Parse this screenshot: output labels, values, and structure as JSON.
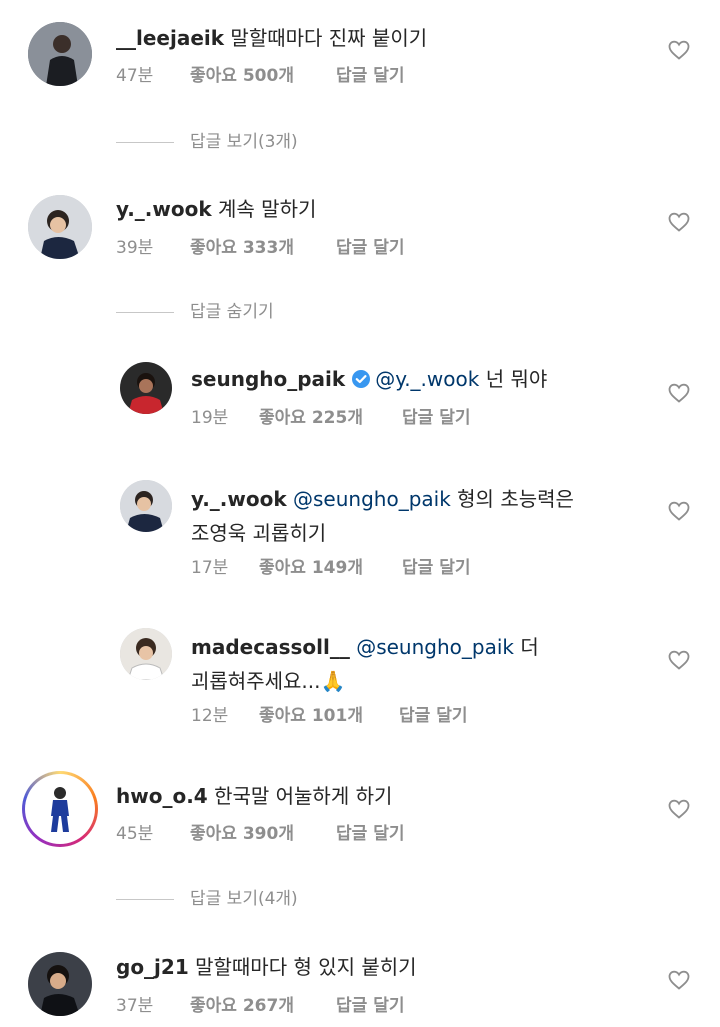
{
  "colors": {
    "mention": "#00376b",
    "meta": "#8e8e8e",
    "verified": "#3897f0"
  },
  "comments": [
    {
      "username": "__leejaeik",
      "text": "말할때마다 진짜 붙이기",
      "time": "47분",
      "likes": "좋아요 500개",
      "reply": "답글 달기",
      "thread": "답글 보기(3개)"
    },
    {
      "username": "y._.wook",
      "text": "계속 말하기",
      "time": "39분",
      "likes": "좋아요 333개",
      "reply": "답글 달기",
      "thread": "답글 숨기기"
    },
    {
      "username": "seungho_paik",
      "mention": "@y._.wook",
      "text": "넌 뭐야",
      "time": "19분",
      "likes": "좋아요 225개",
      "reply": "답글 달기"
    },
    {
      "username": "y._.wook",
      "mention": "@seungho_paik",
      "text": "형의 초능력은",
      "text_line2": "조영욱 괴롭히기",
      "time": "17분",
      "likes": "좋아요 149개",
      "reply": "답글 달기"
    },
    {
      "username": "madecassoll__",
      "mention": "@seungho_paik",
      "text": "더",
      "text_line2": "괴롭혀주세요...🙏",
      "time": "12분",
      "likes": "좋아요 101개",
      "reply": "답글 달기"
    },
    {
      "username": "hwo_o.4",
      "text": "한국말 어눌하게 하기",
      "time": "45분",
      "likes": "좋아요 390개",
      "reply": "답글 달기",
      "thread": "답글 보기(4개)"
    },
    {
      "username": "go_j21",
      "text": "말할때마다 형 있지 붙히기",
      "time": "37분",
      "likes": "좋아요 267개",
      "reply": "답글 달기"
    }
  ]
}
